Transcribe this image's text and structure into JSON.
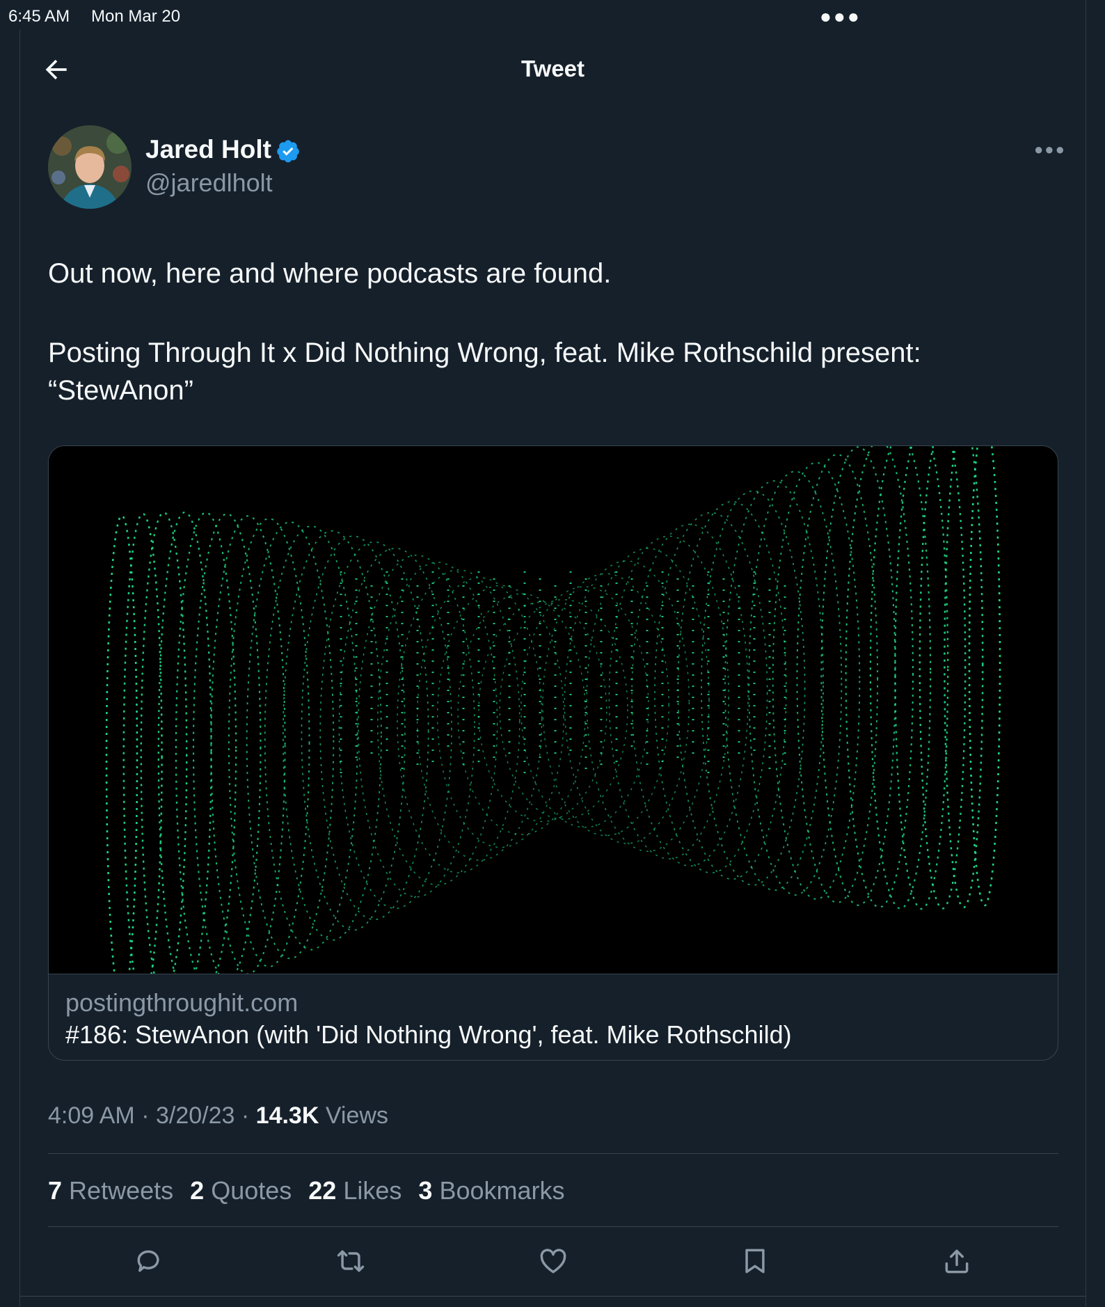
{
  "status_bar": {
    "time": "6:45 AM",
    "date": "Mon Mar 20"
  },
  "header": {
    "title": "Tweet",
    "back_icon": "arrow-left-icon"
  },
  "author": {
    "name": "Jared Holt",
    "handle": "@jaredlholt",
    "verified": true
  },
  "tweet": {
    "paragraphs": [
      "Out now, here and where podcasts are found.",
      "Posting Through It x Did Nothing Wrong, feat. Mike Rothschild present: “StewAnon”"
    ]
  },
  "card": {
    "domain": "postingthroughit.com",
    "title": "#186: StewAnon (with 'Did Nothing Wrong', feat. Mike Rothschild)"
  },
  "meta": {
    "time": "4:09 AM",
    "separator": "·",
    "date": "3/20/23",
    "views_count": "14.3K",
    "views_label": "Views"
  },
  "stats": [
    {
      "count": "7",
      "label": "Retweets"
    },
    {
      "count": "2",
      "label": "Quotes"
    },
    {
      "count": "22",
      "label": "Likes"
    },
    {
      "count": "3",
      "label": "Bookmarks"
    }
  ],
  "actions": [
    "reply-icon",
    "retweet-icon",
    "like-icon",
    "bookmark-icon",
    "share-icon"
  ],
  "colors": {
    "background": "#15202b",
    "accent": "#1d9bf0",
    "muted": "#8b98a5",
    "border": "#38444d",
    "image_green": "#1ee08a"
  }
}
